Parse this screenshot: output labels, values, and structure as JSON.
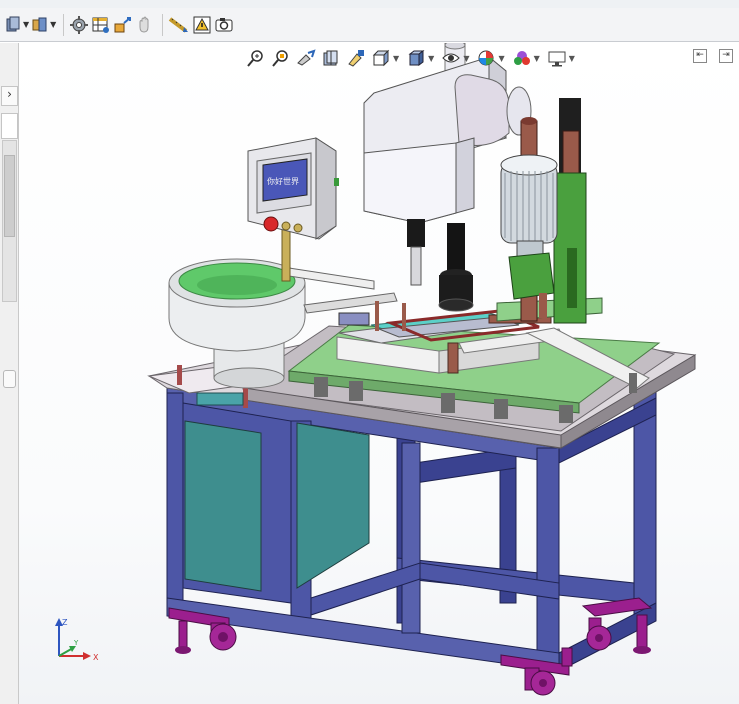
{
  "app": {
    "accent": "#1f66b1",
    "background": "#ffffff"
  },
  "toolbar": {
    "items": [
      {
        "id": "part-icon",
        "dropdown": true
      },
      {
        "id": "assembly-icon",
        "dropdown": true
      },
      {
        "id": "gear-settings-icon",
        "dropdown": false
      },
      {
        "id": "table-icon",
        "dropdown": false
      },
      {
        "id": "move-component-icon",
        "dropdown": false
      },
      {
        "id": "hand-icon",
        "dropdown": false
      },
      {
        "id": "ruler-icon",
        "dropdown": false
      },
      {
        "id": "warning-icon",
        "dropdown": false
      },
      {
        "id": "camera-icon",
        "dropdown": false
      }
    ]
  },
  "heads_up": {
    "items": [
      {
        "id": "zoom-to-fit-icon",
        "dropdown": false
      },
      {
        "id": "zoom-area-icon",
        "dropdown": false
      },
      {
        "id": "previous-view-icon",
        "dropdown": false
      },
      {
        "id": "section-view-icon",
        "dropdown": false
      },
      {
        "id": "dynamic-annotation-icon",
        "dropdown": false
      },
      {
        "id": "view-orientation-icon",
        "dropdown": true
      },
      {
        "id": "display-style-icon",
        "dropdown": true
      },
      {
        "id": "hide-show-icon",
        "dropdown": true
      },
      {
        "id": "edit-appearance-icon",
        "dropdown": true
      },
      {
        "id": "apply-scene-icon",
        "dropdown": true
      },
      {
        "id": "view-settings-icon",
        "dropdown": true
      }
    ]
  },
  "panel_screen_text": "你好世界",
  "triad": {
    "x_label": "X",
    "y_label": "Y",
    "z_label": "Z"
  },
  "colors": {
    "frame": "#4d56a6",
    "frame_dark": "#353c82",
    "table_green": "#8fd08a",
    "table_edge": "#6eaa6a",
    "bowl_inner": "#5fc96a",
    "tray": "#c9c4c8",
    "caster": "#9b1f8e",
    "cabinet": "#3f8f8f",
    "motor": "#cfd6dc",
    "brown": "#9a5a4a",
    "gray_head": "#e9e9ee"
  }
}
